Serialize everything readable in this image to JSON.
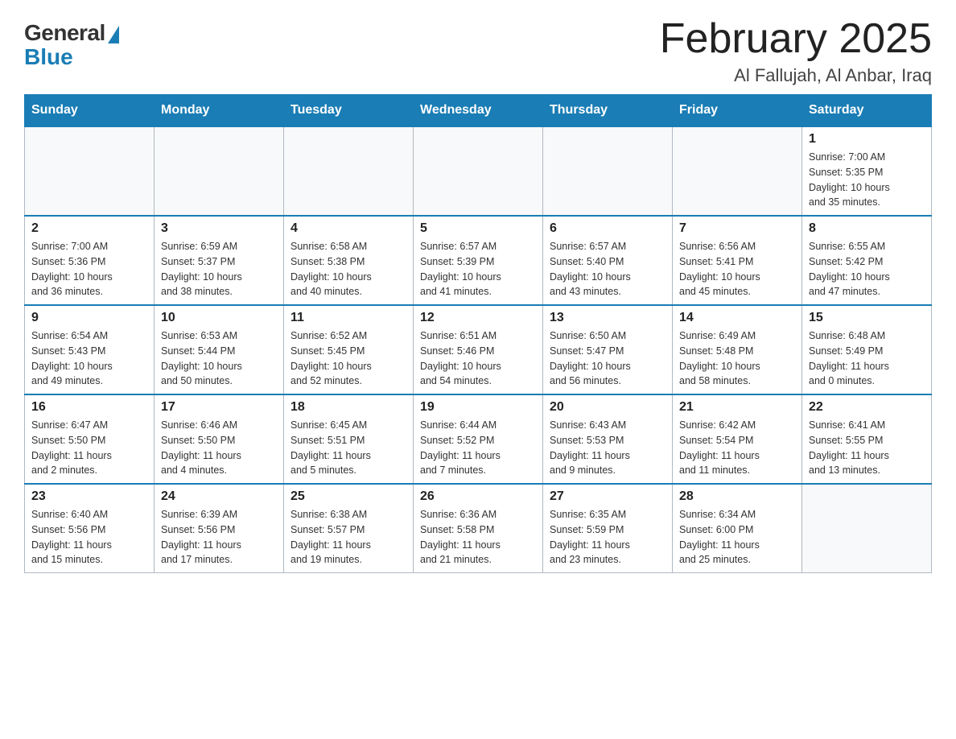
{
  "logo": {
    "general_text": "General",
    "blue_text": "Blue"
  },
  "header": {
    "month_year": "February 2025",
    "location": "Al Fallujah, Al Anbar, Iraq"
  },
  "weekdays": [
    "Sunday",
    "Monday",
    "Tuesday",
    "Wednesday",
    "Thursday",
    "Friday",
    "Saturday"
  ],
  "weeks": [
    [
      {
        "day": "",
        "info": ""
      },
      {
        "day": "",
        "info": ""
      },
      {
        "day": "",
        "info": ""
      },
      {
        "day": "",
        "info": ""
      },
      {
        "day": "",
        "info": ""
      },
      {
        "day": "",
        "info": ""
      },
      {
        "day": "1",
        "info": "Sunrise: 7:00 AM\nSunset: 5:35 PM\nDaylight: 10 hours\nand 35 minutes."
      }
    ],
    [
      {
        "day": "2",
        "info": "Sunrise: 7:00 AM\nSunset: 5:36 PM\nDaylight: 10 hours\nand 36 minutes."
      },
      {
        "day": "3",
        "info": "Sunrise: 6:59 AM\nSunset: 5:37 PM\nDaylight: 10 hours\nand 38 minutes."
      },
      {
        "day": "4",
        "info": "Sunrise: 6:58 AM\nSunset: 5:38 PM\nDaylight: 10 hours\nand 40 minutes."
      },
      {
        "day": "5",
        "info": "Sunrise: 6:57 AM\nSunset: 5:39 PM\nDaylight: 10 hours\nand 41 minutes."
      },
      {
        "day": "6",
        "info": "Sunrise: 6:57 AM\nSunset: 5:40 PM\nDaylight: 10 hours\nand 43 minutes."
      },
      {
        "day": "7",
        "info": "Sunrise: 6:56 AM\nSunset: 5:41 PM\nDaylight: 10 hours\nand 45 minutes."
      },
      {
        "day": "8",
        "info": "Sunrise: 6:55 AM\nSunset: 5:42 PM\nDaylight: 10 hours\nand 47 minutes."
      }
    ],
    [
      {
        "day": "9",
        "info": "Sunrise: 6:54 AM\nSunset: 5:43 PM\nDaylight: 10 hours\nand 49 minutes."
      },
      {
        "day": "10",
        "info": "Sunrise: 6:53 AM\nSunset: 5:44 PM\nDaylight: 10 hours\nand 50 minutes."
      },
      {
        "day": "11",
        "info": "Sunrise: 6:52 AM\nSunset: 5:45 PM\nDaylight: 10 hours\nand 52 minutes."
      },
      {
        "day": "12",
        "info": "Sunrise: 6:51 AM\nSunset: 5:46 PM\nDaylight: 10 hours\nand 54 minutes."
      },
      {
        "day": "13",
        "info": "Sunrise: 6:50 AM\nSunset: 5:47 PM\nDaylight: 10 hours\nand 56 minutes."
      },
      {
        "day": "14",
        "info": "Sunrise: 6:49 AM\nSunset: 5:48 PM\nDaylight: 10 hours\nand 58 minutes."
      },
      {
        "day": "15",
        "info": "Sunrise: 6:48 AM\nSunset: 5:49 PM\nDaylight: 11 hours\nand 0 minutes."
      }
    ],
    [
      {
        "day": "16",
        "info": "Sunrise: 6:47 AM\nSunset: 5:50 PM\nDaylight: 11 hours\nand 2 minutes."
      },
      {
        "day": "17",
        "info": "Sunrise: 6:46 AM\nSunset: 5:50 PM\nDaylight: 11 hours\nand 4 minutes."
      },
      {
        "day": "18",
        "info": "Sunrise: 6:45 AM\nSunset: 5:51 PM\nDaylight: 11 hours\nand 5 minutes."
      },
      {
        "day": "19",
        "info": "Sunrise: 6:44 AM\nSunset: 5:52 PM\nDaylight: 11 hours\nand 7 minutes."
      },
      {
        "day": "20",
        "info": "Sunrise: 6:43 AM\nSunset: 5:53 PM\nDaylight: 11 hours\nand 9 minutes."
      },
      {
        "day": "21",
        "info": "Sunrise: 6:42 AM\nSunset: 5:54 PM\nDaylight: 11 hours\nand 11 minutes."
      },
      {
        "day": "22",
        "info": "Sunrise: 6:41 AM\nSunset: 5:55 PM\nDaylight: 11 hours\nand 13 minutes."
      }
    ],
    [
      {
        "day": "23",
        "info": "Sunrise: 6:40 AM\nSunset: 5:56 PM\nDaylight: 11 hours\nand 15 minutes."
      },
      {
        "day": "24",
        "info": "Sunrise: 6:39 AM\nSunset: 5:56 PM\nDaylight: 11 hours\nand 17 minutes."
      },
      {
        "day": "25",
        "info": "Sunrise: 6:38 AM\nSunset: 5:57 PM\nDaylight: 11 hours\nand 19 minutes."
      },
      {
        "day": "26",
        "info": "Sunrise: 6:36 AM\nSunset: 5:58 PM\nDaylight: 11 hours\nand 21 minutes."
      },
      {
        "day": "27",
        "info": "Sunrise: 6:35 AM\nSunset: 5:59 PM\nDaylight: 11 hours\nand 23 minutes."
      },
      {
        "day": "28",
        "info": "Sunrise: 6:34 AM\nSunset: 6:00 PM\nDaylight: 11 hours\nand 25 minutes."
      },
      {
        "day": "",
        "info": ""
      }
    ]
  ]
}
